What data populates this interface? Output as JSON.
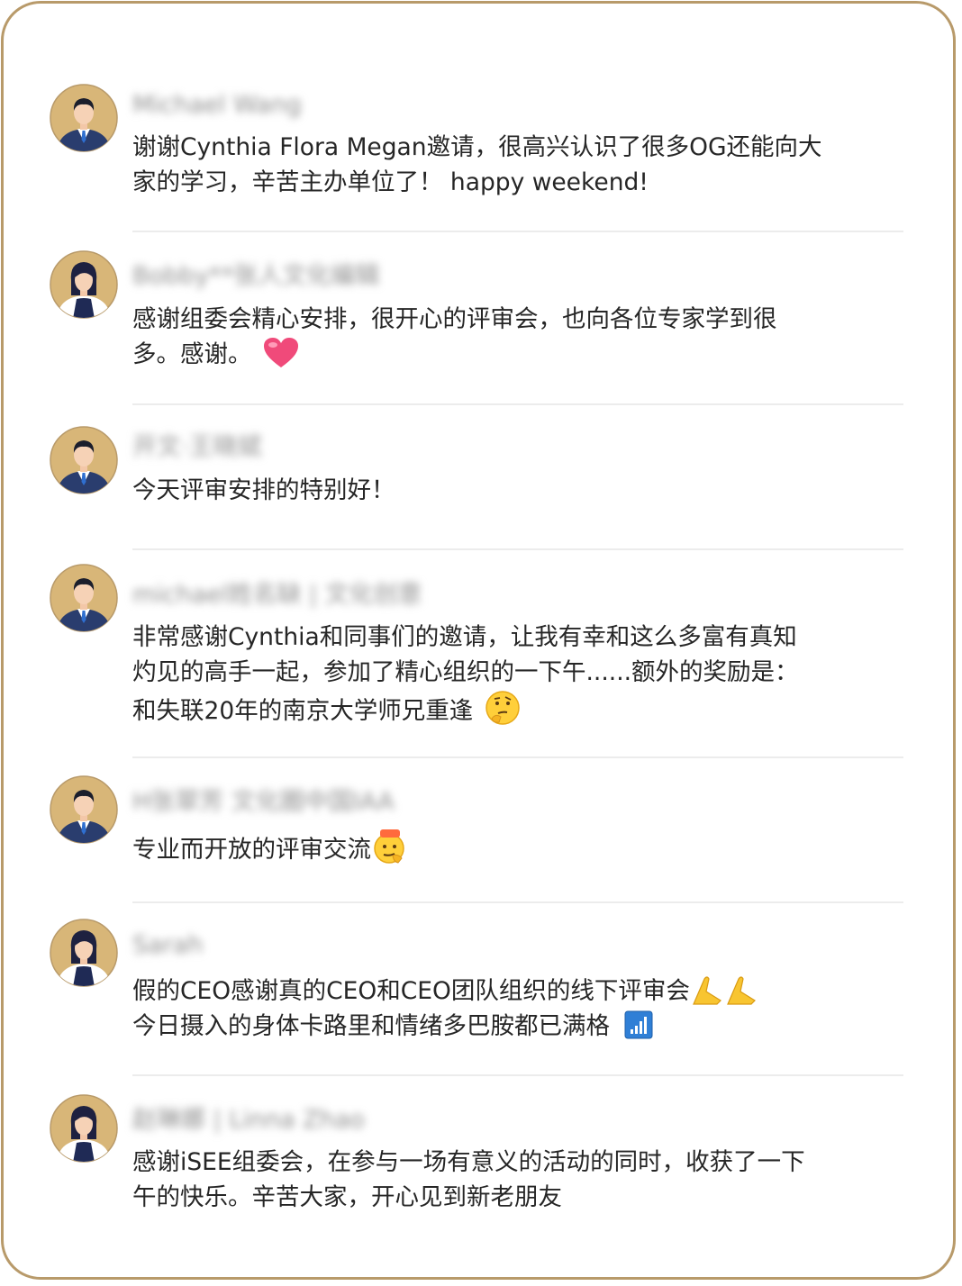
{
  "comments": [
    {
      "name": "Michael Wang",
      "avatar_icon": "male-avatar-icon",
      "lines": [
        "谢谢Cynthia Flora Megan邀请，很高兴认识了很多OG还能向大",
        "家的学习，辛苦主办单位了！ happy weekend!"
      ],
      "emoji": ""
    },
    {
      "name": "Bobby**张人文化编辑",
      "avatar_icon": "female-avatar-icon",
      "lines": [
        "感谢组委会精心安排，很开心的评审会，也向各位专家学到很",
        "多。感谢。"
      ],
      "emoji": "heart-emoji-icon"
    },
    {
      "name": "开文·王晓斌",
      "avatar_icon": "male-avatar-icon",
      "lines": [
        "今天评审安排的特别好！"
      ],
      "emoji": ""
    },
    {
      "name": "michael姓名缺 | 文化创意",
      "avatar_icon": "male-avatar-icon",
      "lines": [
        "非常感谢Cynthia和同事们的邀请，让我有幸和这么多富有真知",
        "灼见的高手一起，参加了精心组织的一下午......额外的奖励是：",
        "和失联20年的南京大学师兄重逢"
      ],
      "emoji": "thinking-face-emoji-icon"
    },
    {
      "name": "H张翠芳 文化圈中国IAA",
      "avatar_icon": "male-avatar-icon",
      "lines": [
        "专业而开放的评审交流"
      ],
      "emoji": "666-face-emoji-icon"
    },
    {
      "name": "Sarah",
      "avatar_icon": "female-avatar-icon",
      "lines": [
        "假的CEO感谢真的CEO和CEO团队组织的线下评审会",
        "今日摄入的身体卡路里和情绪多巴胺都已满格"
      ],
      "emoji": "praying-hands-emoji-icon",
      "emoji2": "signal-bars-emoji-icon"
    },
    {
      "name": "赵琳娜 | Linna Zhao",
      "avatar_icon": "female-avatar-icon",
      "lines": [
        "感谢iSEE组委会，在参与一场有意义的活动的同时，收获了一下",
        "午的快乐。辛苦大家，开心见到新老朋友"
      ],
      "emoji": ""
    }
  ],
  "colors": {
    "border": "#b89a6a",
    "avatar_bg": "#d8b678",
    "text": "#262626",
    "divider": "#ececec"
  }
}
